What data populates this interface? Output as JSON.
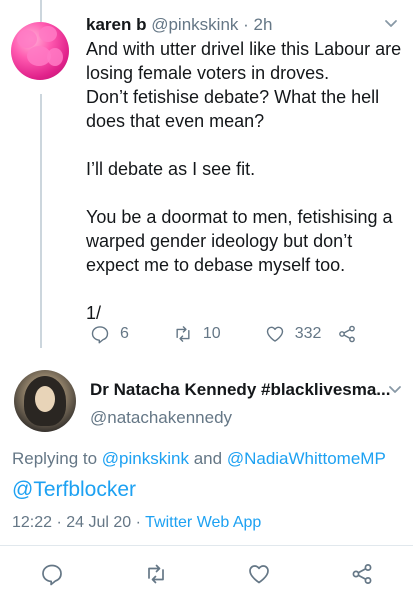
{
  "tweet1": {
    "name": "karen b",
    "handle": "@pinkskink",
    "time": "· 2h",
    "body": "And with utter drivel like this Labour are losing female voters in droves.\nDon’t fetishise debate? What the hell does that even mean?\n\nI’ll debate as I see fit.\n\nYou be a doormat to men, fetishising a warped gender ideology but don’t expect me to debase myself too.\n\n1/",
    "replies": "6",
    "retweets": "10",
    "likes": "332"
  },
  "tweet2": {
    "name": "Dr Natacha Kennedy #blacklivesma...",
    "handle": "@natachakennedy",
    "replying_prefix": "Replying to",
    "replying_user1": "@pinkskink",
    "replying_and": "and",
    "replying_user2": "@NadiaWhittomeMP",
    "mention": "@Terfblocker",
    "timestamp": "12:22 · 24 Jul 20 ·",
    "source": "Twitter Web App"
  },
  "colors": {
    "accent": "#1da1f2",
    "secondary_text": "#657786",
    "primary_text": "#14171a"
  },
  "icons": {
    "reply": "reply-icon",
    "retweet": "retweet-icon",
    "like": "heart-icon",
    "share": "share-icon",
    "more": "chevron-down-icon"
  }
}
